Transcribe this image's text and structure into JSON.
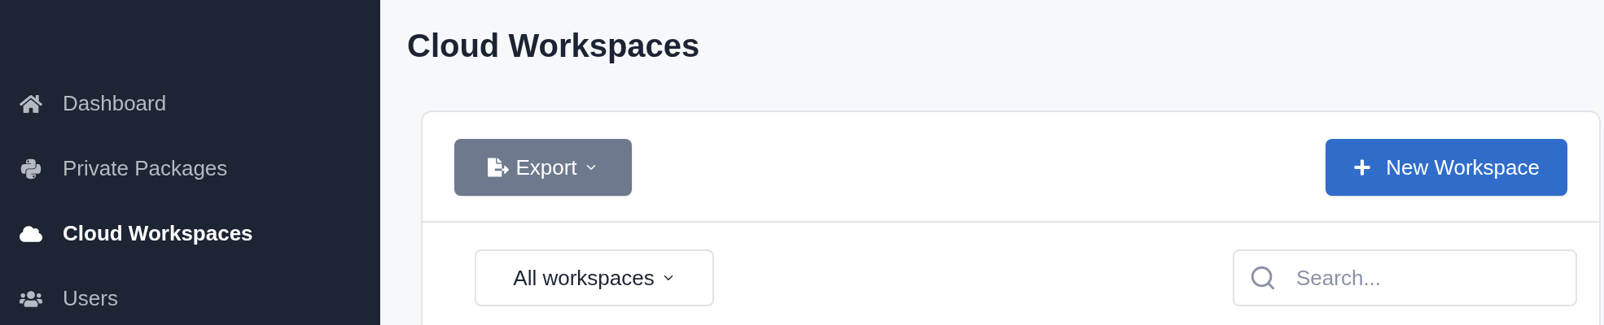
{
  "sidebar": {
    "items": [
      {
        "label": "Dashboard",
        "selected": false
      },
      {
        "label": "Private Packages",
        "selected": false
      },
      {
        "label": "Cloud Workspaces",
        "selected": true
      },
      {
        "label": "Users",
        "selected": false
      }
    ]
  },
  "page": {
    "title": "Cloud Workspaces"
  },
  "toolbar": {
    "export_button": {
      "label": "Export"
    },
    "new_button": {
      "label": "New Workspace"
    }
  },
  "filters": {
    "scope_dropdown": {
      "value": "All workspaces"
    },
    "search": {
      "placeholder": "Search..."
    }
  }
}
